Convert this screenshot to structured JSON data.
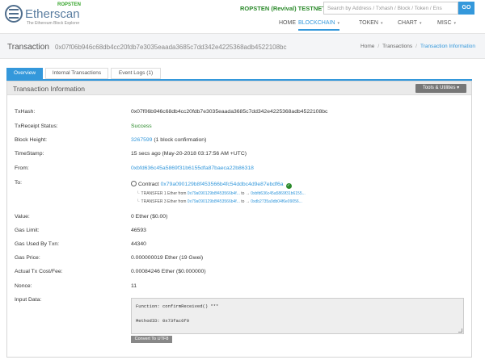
{
  "header": {
    "logo_name": "Etherscan",
    "logo_network": "ROPSTEN",
    "logo_tagline": "The Ethereum Block Explorer",
    "network_badge": "ROPSTEN (Revival) TESTNET",
    "search_placeholder": "Search by Address / Txhash / Block / Token / Ens",
    "go_label": "GO",
    "nav": [
      {
        "label": "HOME"
      },
      {
        "label": "BLOCKCHAIN"
      },
      {
        "label": "TOKEN"
      },
      {
        "label": "CHART"
      },
      {
        "label": "MISC"
      }
    ]
  },
  "titlebar": {
    "title": "Transaction",
    "hash": "0x07f06b946c68db4cc20fdb7e3035eaada3685c7dd342e4225368adb4522108bc",
    "breadcrumb": [
      "Home",
      "Transactions",
      "Transaction Information"
    ],
    "breadcrumb_sep": "/"
  },
  "tabs": [
    {
      "label": "Overview"
    },
    {
      "label": "Internal Transactions"
    },
    {
      "label": "Event Logs (1)"
    }
  ],
  "panel": {
    "title": "Transaction Information",
    "tools_label": "Tools & Utilities",
    "tools_chevron": "▾"
  },
  "fields": {
    "txhash": {
      "label": "TxHash:",
      "value": "0x07f06b946c68db4cc20fdb7e3035eaada3685c7dd342e4225368adb4522108bc"
    },
    "status": {
      "label": "TxReceipt Status:",
      "value": "Success"
    },
    "block": {
      "label": "Block Height:",
      "value": "3267599",
      "extra": "(1 block confirmation)"
    },
    "timestamp": {
      "label": "TimeStamp:",
      "value": "15 secs ago (May-20-2018 03:17:56 AM +UTC)"
    },
    "from": {
      "label": "From:",
      "value": "0xbfd636c45a5869f31b6155dfa87baeca22b86318"
    },
    "to": {
      "label": "To:",
      "prefix": "Contract",
      "value": "0x79a090129b8f453566b4fc54ddbc4d9e87ebdf6a",
      "transfers": [
        {
          "prefix": "TRANSFER",
          "amount": "1 Ether from",
          "from": "0x79a090129b8f453566b4f...",
          "to_label": "to",
          "to": "0xbfd636c45a5869f31b6155..."
        },
        {
          "prefix": "TRANSFER",
          "amount": "3 Ether from",
          "from": "0x79a090129b8f453566b4f...",
          "to_label": "to",
          "to": "0xdb2735a9db04f6e09056..."
        }
      ]
    },
    "value": {
      "label": "Value:",
      "value": "0 Ether ($0.00)"
    },
    "gas_limit": {
      "label": "Gas Limit:",
      "value": "46593"
    },
    "gas_used": {
      "label": "Gas Used By Txn:",
      "value": "44340"
    },
    "gas_price": {
      "label": "Gas Price:",
      "value": "0.000000019 Ether (19 Gwei)"
    },
    "fee": {
      "label": "Actual Tx Cost/Fee:",
      "value": "0.00084246 Ether ($0.000000)"
    },
    "nonce": {
      "label": "Nonce:",
      "value": "11"
    },
    "input": {
      "label": "Input Data:",
      "line1": "Function: confirmReceived() ***",
      "line2": "MethodID: 0x73fac6f0",
      "convert_label": "Convert To UTF8"
    }
  },
  "colors": {
    "accent": "#3498db",
    "success": "#2b8a2b",
    "network": "#35a52a"
  }
}
